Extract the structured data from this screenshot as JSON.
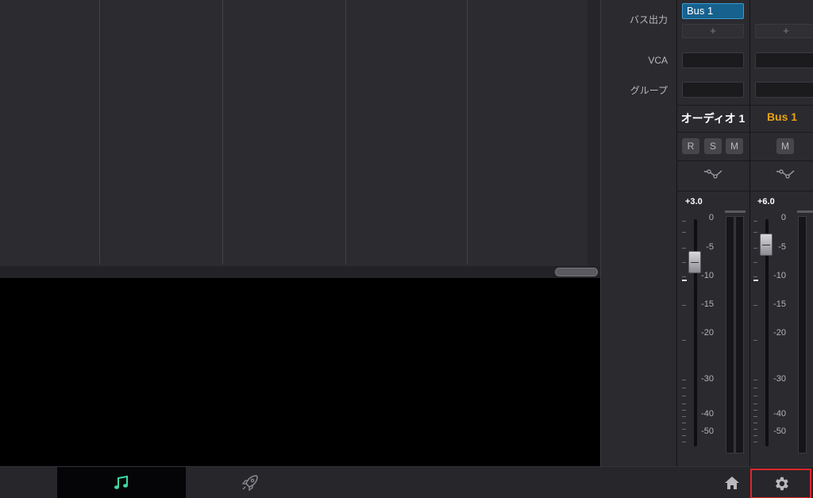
{
  "mixer": {
    "row_labels": {
      "bus_output": "バス出力",
      "vca": "VCA",
      "group": "グループ"
    },
    "channels": [
      {
        "name": "オーディオ 1",
        "name_color": "#ffffff",
        "bus_assignment": "Bus 1",
        "add_label": "+",
        "buttons": [
          "R",
          "S",
          "M"
        ],
        "gain": "+3.0",
        "fader_db": -7.5
      },
      {
        "name": "Bus 1",
        "name_color": "#e8a317",
        "bus_assignment": "",
        "add_label": "+",
        "buttons": [
          "M"
        ],
        "gain": "+6.0",
        "fader_db": -4.5
      }
    ],
    "scale": [
      "0",
      "-5",
      "-10",
      "-15",
      "-20",
      "-30",
      "-40",
      "-50"
    ]
  },
  "bottom_bar": {
    "tabs": [
      {
        "name": "fairlight",
        "icon": "music-note-icon",
        "active": true
      },
      {
        "name": "deliver",
        "icon": "rocket-icon",
        "active": false
      }
    ],
    "home_icon": "home-icon",
    "settings_icon": "gear-icon"
  },
  "colors": {
    "accent": "#16618e",
    "active_tab_icon": "#3fd6a2",
    "bus_name": "#e8a317",
    "highlight_box": "#e0262a"
  }
}
